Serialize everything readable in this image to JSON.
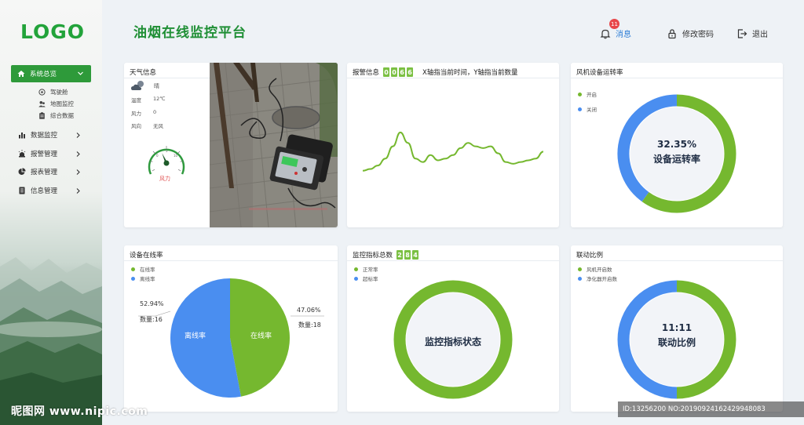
{
  "sidebar": {
    "logo": "LOGO",
    "active_item": {
      "label": "系统总览",
      "icon": "home-icon"
    },
    "sub_items": [
      {
        "label": "驾驶舱",
        "icon": "dashboard-icon"
      },
      {
        "label": "地图监控",
        "icon": "users-icon"
      },
      {
        "label": "综合数据",
        "icon": "clipboard-icon"
      }
    ],
    "items": [
      {
        "label": "数据监控",
        "icon": "bar-chart-icon"
      },
      {
        "label": "报警管理",
        "icon": "alarm-icon"
      },
      {
        "label": "报表管理",
        "icon": "pie-chart-icon"
      },
      {
        "label": "信息管理",
        "icon": "document-icon"
      }
    ]
  },
  "header": {
    "title": "油烟在线监控平台",
    "message_label": "消息",
    "message_count": "11",
    "change_password_label": "修改密码",
    "logout_label": "退出"
  },
  "weather": {
    "title": "天气信息",
    "condition": "晴",
    "rows": [
      {
        "key": "温度",
        "value": "12℃"
      },
      {
        "key": "风力",
        "value": "0"
      },
      {
        "key": "风向",
        "value": "无风"
      }
    ],
    "gauge_label": "风力",
    "gauge_ticks": [
      "0",
      "5",
      "10"
    ],
    "gauge_value": 4
  },
  "alarm": {
    "title": "报警信息",
    "digits": [
      "0",
      "0",
      "6",
      "6"
    ],
    "description": "X轴指当前时间，Y轴指当前数量"
  },
  "fan": {
    "title": "风机设备运转率",
    "legend": [
      "开启",
      "关闭"
    ],
    "percent_label": "32.35%",
    "center_label": "设备运转率",
    "values": [
      60,
      40
    ]
  },
  "online": {
    "title": "设备在线率",
    "legend": [
      "在线率",
      "离线率"
    ],
    "online_label": "在线率",
    "offline_label": "离线率",
    "online_pct": "47.06%",
    "online_count": "数量:18",
    "offline_pct": "52.94%",
    "offline_count": "数量:16"
  },
  "monitor": {
    "title": "监控指标总数",
    "digits": [
      "2",
      "8",
      "4"
    ],
    "legend": [
      "正常率",
      "超标率"
    ],
    "center_label": "监控指标状态"
  },
  "link": {
    "title": "联动比例",
    "legend": [
      "风机开启数",
      "净化器开启数"
    ],
    "ratio_label": "11:11",
    "center_label": "联动比例"
  },
  "colors": {
    "green": "#75b82f",
    "blue": "#4a8ef0",
    "brand": "#22a33a"
  },
  "chart_data": [
    {
      "type": "line",
      "x": [
        0,
        1,
        2,
        3,
        4,
        5,
        6,
        7,
        8,
        9,
        10,
        11,
        12,
        13,
        14,
        15,
        16,
        17,
        18,
        19,
        20,
        21,
        22,
        23,
        24
      ],
      "values": [
        10,
        11,
        13,
        17,
        24,
        32,
        26,
        17,
        15,
        19,
        16,
        17,
        19,
        23,
        26,
        24,
        23,
        24,
        20,
        15,
        14,
        15,
        16,
        17,
        21
      ],
      "ylim": [
        0,
        45
      ],
      "grid": false
    },
    {
      "type": "pie",
      "categories": [
        "开启",
        "关闭"
      ],
      "values": [
        60,
        40
      ]
    },
    {
      "type": "pie",
      "categories": [
        "在线率",
        "离线率"
      ],
      "values": [
        47.06,
        52.94
      ]
    },
    {
      "type": "pie",
      "categories": [
        "正常率",
        "超标率"
      ],
      "values": [
        100,
        0
      ]
    },
    {
      "type": "pie",
      "categories": [
        "风机开启数",
        "净化器开启数"
      ],
      "values": [
        50,
        50
      ]
    }
  ]
}
